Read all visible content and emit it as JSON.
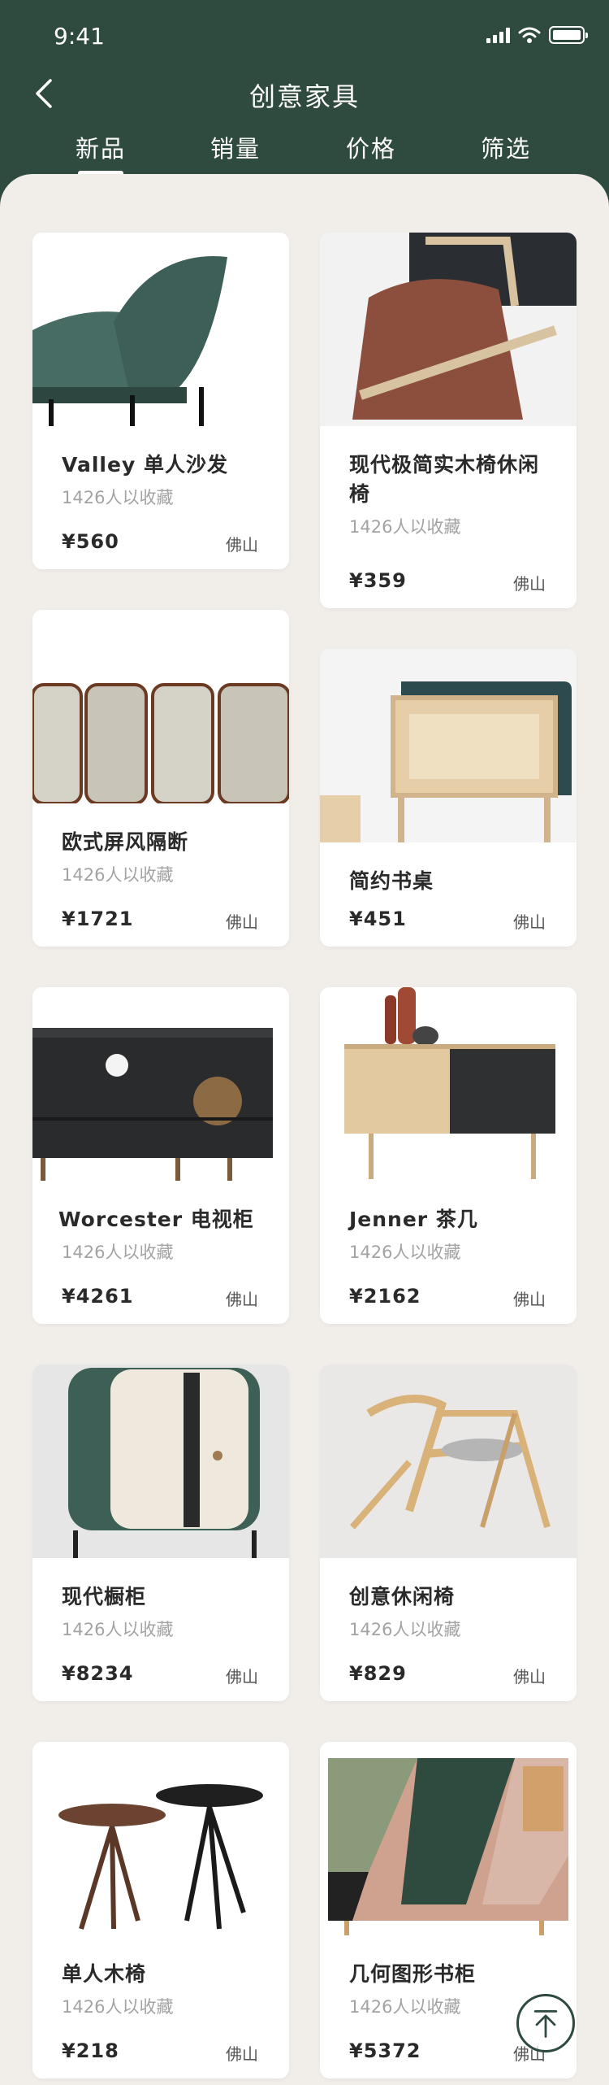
{
  "status": {
    "time": "9:41"
  },
  "header": {
    "title": "创意家具"
  },
  "tabs": [
    {
      "label": "新品"
    },
    {
      "label": "销量"
    },
    {
      "label": "价格"
    },
    {
      "label": "筛选"
    }
  ],
  "colors": {
    "brand": "#2f4a3e",
    "background": "#f1ede9"
  },
  "icons": [
    "back-arrow-icon",
    "signal-icon",
    "wifi-icon",
    "battery-icon",
    "scroll-to-top-icon"
  ],
  "products": [
    {
      "name": "Valley 单人沙发",
      "fav": "1426人以收藏",
      "price": "¥560",
      "loc": "佛山"
    },
    {
      "name": "现代极简实木椅休闲椅",
      "fav": "1426人以收藏",
      "price": "¥359",
      "loc": "佛山"
    },
    {
      "name": "欧式屏风隔断",
      "fav": "1426人以收藏",
      "price": "¥1721",
      "loc": "佛山"
    },
    {
      "name": "简约书桌",
      "fav": "",
      "price": "¥451",
      "loc": "佛山"
    },
    {
      "name": "Worcester 电视柜",
      "fav": "1426人以收藏",
      "price": "¥4261",
      "loc": "佛山"
    },
    {
      "name": "Jenner 茶几",
      "fav": "1426人以收藏",
      "price": "¥2162",
      "loc": "佛山"
    },
    {
      "name": "现代橱柜",
      "fav": "1426人以收藏",
      "price": "¥8234",
      "loc": "佛山"
    },
    {
      "name": "创意休闲椅",
      "fav": "1426人以收藏",
      "price": "¥829",
      "loc": "佛山"
    },
    {
      "name": "单人木椅",
      "fav": "1426人以收藏",
      "price": "¥218",
      "loc": "佛山"
    },
    {
      "name": "几何图形书柜",
      "fav": "1426人以收藏",
      "price": "¥5372",
      "loc": "佛山"
    }
  ]
}
